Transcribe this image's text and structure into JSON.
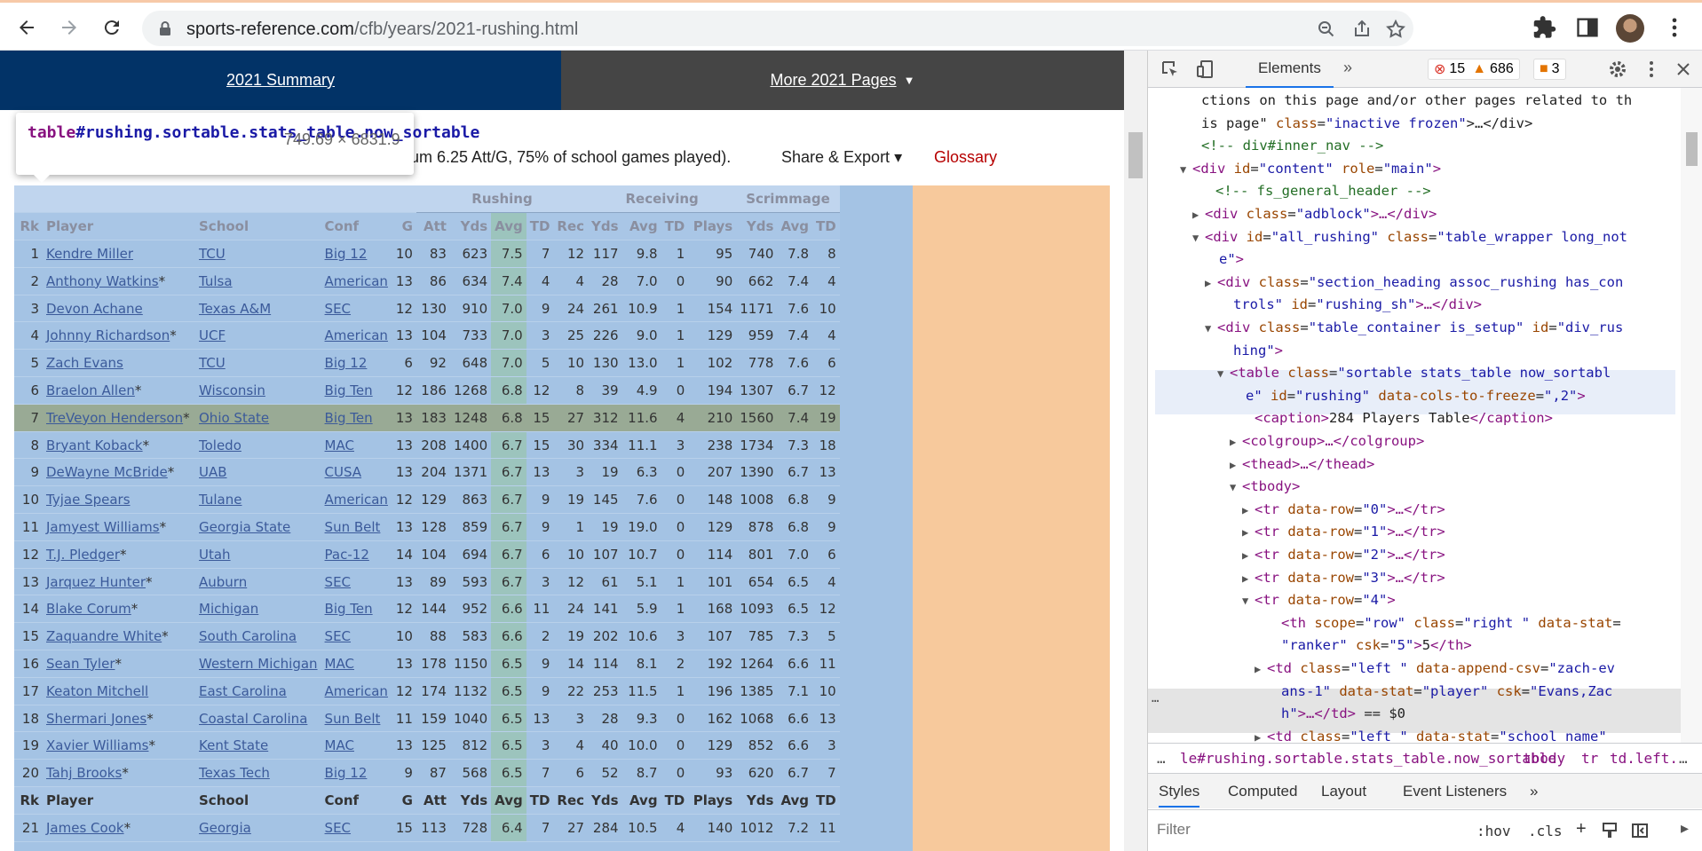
{
  "browser": {
    "url_domain": "sports-reference.com",
    "url_path": "/cfb/years/2021-rushing.html"
  },
  "nav": {
    "summary": "2021 Summary",
    "more": "More 2021 Pages"
  },
  "desc": {
    "text": "num 6.25 Att/G, 75% of school games played).",
    "share": "Share & Export ▾",
    "glossary": "Glossary"
  },
  "tooltip": {
    "tag": "table",
    "selector": "#rushing.sortable.stats_table.now_sortable",
    "dims": "749.69 × 6831.9"
  },
  "table": {
    "groups": [
      "Rushing",
      "Receiving",
      "Scrimmage"
    ],
    "columns": [
      "Rk",
      "Player",
      "School",
      "Conf",
      "G",
      "Att",
      "Yds",
      "Avg",
      "TD",
      "Rec",
      "Yds",
      "Avg",
      "TD",
      "Plays",
      "Yds",
      "Avg",
      "TD"
    ],
    "rows": [
      [
        "1",
        "Kendre Miller",
        "",
        "TCU",
        "Big 12",
        "10",
        "83",
        "623",
        "7.5",
        "7",
        "12",
        "117",
        "9.8",
        "1",
        "95",
        "740",
        "7.8",
        "8"
      ],
      [
        "2",
        "Anthony Watkins",
        "*",
        "Tulsa",
        "American",
        "13",
        "86",
        "634",
        "7.4",
        "4",
        "4",
        "28",
        "7.0",
        "0",
        "90",
        "662",
        "7.4",
        "4"
      ],
      [
        "3",
        "Devon Achane",
        "",
        "Texas A&M",
        "SEC",
        "12",
        "130",
        "910",
        "7.0",
        "9",
        "24",
        "261",
        "10.9",
        "1",
        "154",
        "1171",
        "7.6",
        "10"
      ],
      [
        "4",
        "Johnny Richardson",
        "*",
        "UCF",
        "American",
        "13",
        "104",
        "733",
        "7.0",
        "3",
        "25",
        "226",
        "9.0",
        "1",
        "129",
        "959",
        "7.4",
        "4"
      ],
      [
        "5",
        "Zach Evans",
        "",
        "TCU",
        "Big 12",
        "6",
        "92",
        "648",
        "7.0",
        "5",
        "10",
        "130",
        "13.0",
        "1",
        "102",
        "778",
        "7.6",
        "6"
      ],
      [
        "6",
        "Braelon Allen",
        "*",
        "Wisconsin",
        "Big Ten",
        "12",
        "186",
        "1268",
        "6.8",
        "12",
        "8",
        "39",
        "4.9",
        "0",
        "194",
        "1307",
        "6.7",
        "12"
      ],
      [
        "7",
        "TreVeyon Henderson",
        "*",
        "Ohio State",
        "Big Ten",
        "13",
        "183",
        "1248",
        "6.8",
        "15",
        "27",
        "312",
        "11.6",
        "4",
        "210",
        "1560",
        "7.4",
        "19"
      ],
      [
        "8",
        "Bryant Koback",
        "*",
        "Toledo",
        "MAC",
        "13",
        "208",
        "1400",
        "6.7",
        "15",
        "30",
        "334",
        "11.1",
        "3",
        "238",
        "1734",
        "7.3",
        "18"
      ],
      [
        "9",
        "DeWayne McBride",
        "*",
        "UAB",
        "CUSA",
        "13",
        "204",
        "1371",
        "6.7",
        "13",
        "3",
        "19",
        "6.3",
        "0",
        "207",
        "1390",
        "6.7",
        "13"
      ],
      [
        "10",
        "Tyjae Spears",
        "",
        "Tulane",
        "American",
        "12",
        "129",
        "863",
        "6.7",
        "9",
        "19",
        "145",
        "7.6",
        "0",
        "148",
        "1008",
        "6.8",
        "9"
      ],
      [
        "11",
        "Jamyest Williams",
        "*",
        "Georgia State",
        "Sun Belt",
        "13",
        "128",
        "859",
        "6.7",
        "9",
        "1",
        "19",
        "19.0",
        "0",
        "129",
        "878",
        "6.8",
        "9"
      ],
      [
        "12",
        "T.J. Pledger",
        "*",
        "Utah",
        "Pac-12",
        "14",
        "104",
        "694",
        "6.7",
        "6",
        "10",
        "107",
        "10.7",
        "0",
        "114",
        "801",
        "7.0",
        "6"
      ],
      [
        "13",
        "Jarquez Hunter",
        "*",
        "Auburn",
        "SEC",
        "13",
        "89",
        "593",
        "6.7",
        "3",
        "12",
        "61",
        "5.1",
        "1",
        "101",
        "654",
        "6.5",
        "4"
      ],
      [
        "14",
        "Blake Corum",
        "*",
        "Michigan",
        "Big Ten",
        "12",
        "144",
        "952",
        "6.6",
        "11",
        "24",
        "141",
        "5.9",
        "1",
        "168",
        "1093",
        "6.5",
        "12"
      ],
      [
        "15",
        "Zaquandre White",
        "*",
        "South Carolina",
        "SEC",
        "10",
        "88",
        "583",
        "6.6",
        "2",
        "19",
        "202",
        "10.6",
        "3",
        "107",
        "785",
        "7.3",
        "5"
      ],
      [
        "16",
        "Sean Tyler",
        "*",
        "Western Michigan",
        "MAC",
        "13",
        "178",
        "1150",
        "6.5",
        "9",
        "14",
        "114",
        "8.1",
        "2",
        "192",
        "1264",
        "6.6",
        "11"
      ],
      [
        "17",
        "Keaton Mitchell",
        "",
        "East Carolina",
        "American",
        "12",
        "174",
        "1132",
        "6.5",
        "9",
        "22",
        "253",
        "11.5",
        "1",
        "196",
        "1385",
        "7.1",
        "10"
      ],
      [
        "18",
        "Shermari Jones",
        "*",
        "Coastal Carolina",
        "Sun Belt",
        "11",
        "159",
        "1040",
        "6.5",
        "13",
        "3",
        "28",
        "9.3",
        "0",
        "162",
        "1068",
        "6.6",
        "13"
      ],
      [
        "19",
        "Xavier Williams",
        "*",
        "Kent State",
        "MAC",
        "13",
        "125",
        "812",
        "6.5",
        "3",
        "4",
        "40",
        "10.0",
        "0",
        "129",
        "852",
        "6.6",
        "3"
      ],
      [
        "20",
        "Tahj Brooks",
        "*",
        "Texas Tech",
        "Big 12",
        "9",
        "87",
        "568",
        "6.5",
        "7",
        "6",
        "52",
        "8.7",
        "0",
        "93",
        "620",
        "6.7",
        "7"
      ]
    ],
    "highlight_row": 6,
    "repeat_header": [
      "Rk",
      "Player",
      "School",
      "Conf",
      "G",
      "Att",
      "Yds",
      "Avg",
      "TD",
      "Rec",
      "Yds",
      "Avg",
      "TD",
      "Plays",
      "Yds",
      "Avg",
      "TD"
    ],
    "last_row": [
      "21",
      "James Cook",
      "*",
      "Georgia",
      "SEC",
      "15",
      "113",
      "728",
      "6.4",
      "7",
      "27",
      "284",
      "10.5",
      "4",
      "140",
      "1012",
      "7.2",
      "11"
    ]
  },
  "devtools": {
    "tab": "Elements",
    "errors": "15",
    "warnings": "686",
    "issues": "3",
    "dom_lines": [
      {
        "indent": 60,
        "parts": [
          [
            "tx",
            "ctions on this page and/or other pages related to th"
          ]
        ]
      },
      {
        "indent": 60,
        "parts": [
          [
            "tx",
            "is page\" "
          ],
          [
            "an",
            "class"
          ],
          [
            "tx",
            "="
          ],
          [
            "av",
            "\"inactive frozen\""
          ],
          [
            "tx",
            ">…</div>"
          ]
        ]
      },
      {
        "indent": 60,
        "parts": [
          [
            "cm",
            "<!-- div#inner_nav -->"
          ]
        ]
      },
      {
        "indent": 52,
        "tri": "▼",
        "parts": [
          [
            "tg",
            "<div "
          ],
          [
            "an",
            "id"
          ],
          [
            "tx",
            "="
          ],
          [
            "av",
            "\"content\""
          ],
          [
            "tx",
            " "
          ],
          [
            "an",
            "role"
          ],
          [
            "tx",
            "="
          ],
          [
            "av",
            "\"main\""
          ],
          [
            "tg",
            ">"
          ]
        ]
      },
      {
        "indent": 76,
        "parts": [
          [
            "cm",
            "<!-- fs_general_header -->"
          ]
        ]
      },
      {
        "indent": 66,
        "tri": "▶",
        "parts": [
          [
            "tg",
            "<div "
          ],
          [
            "an",
            "class"
          ],
          [
            "tx",
            "="
          ],
          [
            "av",
            "\"adblock\""
          ],
          [
            "tg",
            ">…</div>"
          ]
        ]
      },
      {
        "indent": 66,
        "tri": "▼",
        "parts": [
          [
            "tg",
            "<div "
          ],
          [
            "an",
            "id"
          ],
          [
            "tx",
            "="
          ],
          [
            "av",
            "\"all_rushing\""
          ],
          [
            "tx",
            " "
          ],
          [
            "an",
            "class"
          ],
          [
            "tx",
            "="
          ],
          [
            "av",
            "\"table_wrapper long_not"
          ]
        ]
      },
      {
        "indent": 80,
        "parts": [
          [
            "av",
            "e\""
          ],
          [
            "tg",
            ">"
          ]
        ]
      },
      {
        "indent": 80,
        "tri": "▶",
        "parts": [
          [
            "tg",
            "<div "
          ],
          [
            "an",
            "class"
          ],
          [
            "tx",
            "="
          ],
          [
            "av",
            "\"section_heading assoc_rushing has_con"
          ]
        ]
      },
      {
        "indent": 96,
        "parts": [
          [
            "av",
            "trols\""
          ],
          [
            "tx",
            " "
          ],
          [
            "an",
            "id"
          ],
          [
            "tx",
            "="
          ],
          [
            "av",
            "\"rushing_sh\""
          ],
          [
            "tg",
            ">…</div>"
          ]
        ]
      },
      {
        "indent": 80,
        "tri": "▼",
        "parts": [
          [
            "tg",
            "<div "
          ],
          [
            "an",
            "class"
          ],
          [
            "tx",
            "="
          ],
          [
            "av",
            "\"table_container is_setup\""
          ],
          [
            "tx",
            " "
          ],
          [
            "an",
            "id"
          ],
          [
            "tx",
            "="
          ],
          [
            "av",
            "\"div_rus"
          ]
        ]
      },
      {
        "indent": 96,
        "parts": [
          [
            "av",
            "hing\""
          ],
          [
            "tg",
            ">"
          ]
        ]
      },
      {
        "indent": 94,
        "tri": "▼",
        "parts": [
          [
            "tg",
            "<table "
          ],
          [
            "an",
            "class"
          ],
          [
            "tx",
            "="
          ],
          [
            "av",
            "\"sortable stats_table now_sortabl"
          ]
        ]
      },
      {
        "indent": 110,
        "parts": [
          [
            "av",
            "e\""
          ],
          [
            "tx",
            " "
          ],
          [
            "an",
            "id"
          ],
          [
            "tx",
            "="
          ],
          [
            "av",
            "\"rushing\""
          ],
          [
            "tx",
            " "
          ],
          [
            "an",
            "data-cols-to-freeze"
          ],
          [
            "tx",
            "="
          ],
          [
            "av",
            "\",2\""
          ],
          [
            "tg",
            ">"
          ]
        ]
      },
      {
        "indent": 120,
        "parts": [
          [
            "tg",
            "<caption>"
          ],
          [
            "tx",
            "284 Players Table"
          ],
          [
            "tg",
            "</caption>"
          ]
        ]
      },
      {
        "indent": 108,
        "tri": "▶",
        "parts": [
          [
            "tg",
            "<colgroup>…</colgroup>"
          ]
        ]
      },
      {
        "indent": 108,
        "tri": "▶",
        "parts": [
          [
            "tg",
            "<thead>…</thead>"
          ]
        ]
      },
      {
        "indent": 108,
        "tri": "▼",
        "parts": [
          [
            "tg",
            "<tbody>"
          ]
        ]
      },
      {
        "indent": 122,
        "tri": "▶",
        "parts": [
          [
            "tg",
            "<tr "
          ],
          [
            "an",
            "data-row"
          ],
          [
            "tx",
            "="
          ],
          [
            "av",
            "\"0\""
          ],
          [
            "tg",
            ">…</tr>"
          ]
        ]
      },
      {
        "indent": 122,
        "tri": "▶",
        "parts": [
          [
            "tg",
            "<tr "
          ],
          [
            "an",
            "data-row"
          ],
          [
            "tx",
            "="
          ],
          [
            "av",
            "\"1\""
          ],
          [
            "tg",
            ">…</tr>"
          ]
        ]
      },
      {
        "indent": 122,
        "tri": "▶",
        "parts": [
          [
            "tg",
            "<tr "
          ],
          [
            "an",
            "data-row"
          ],
          [
            "tx",
            "="
          ],
          [
            "av",
            "\"2\""
          ],
          [
            "tg",
            ">…</tr>"
          ]
        ]
      },
      {
        "indent": 122,
        "tri": "▶",
        "parts": [
          [
            "tg",
            "<tr "
          ],
          [
            "an",
            "data-row"
          ],
          [
            "tx",
            "="
          ],
          [
            "av",
            "\"3\""
          ],
          [
            "tg",
            ">…</tr>"
          ]
        ]
      },
      {
        "indent": 122,
        "tri": "▼",
        "parts": [
          [
            "tg",
            "<tr "
          ],
          [
            "an",
            "data-row"
          ],
          [
            "tx",
            "="
          ],
          [
            "av",
            "\"4\""
          ],
          [
            "tg",
            ">"
          ]
        ]
      },
      {
        "indent": 150,
        "parts": [
          [
            "tg",
            "<th "
          ],
          [
            "an",
            "scope"
          ],
          [
            "tx",
            "="
          ],
          [
            "av",
            "\"row\""
          ],
          [
            "tx",
            " "
          ],
          [
            "an",
            "class"
          ],
          [
            "tx",
            "="
          ],
          [
            "av",
            "\"right \""
          ],
          [
            "tx",
            " "
          ],
          [
            "an",
            "data-stat"
          ],
          [
            "tx",
            "="
          ]
        ]
      },
      {
        "indent": 150,
        "parts": [
          [
            "av",
            "\"ranker\""
          ],
          [
            "tx",
            " "
          ],
          [
            "an",
            "csk"
          ],
          [
            "tx",
            "="
          ],
          [
            "av",
            "\"5\""
          ],
          [
            "tg",
            ">"
          ],
          [
            "tx",
            "5"
          ],
          [
            "tg",
            "</th>"
          ]
        ]
      },
      {
        "indent": 136,
        "tri": "▶",
        "parts": [
          [
            "tg",
            "<td "
          ],
          [
            "an",
            "class"
          ],
          [
            "tx",
            "="
          ],
          [
            "av",
            "\"left \""
          ],
          [
            "tx",
            " "
          ],
          [
            "an",
            "data-append-csv"
          ],
          [
            "tx",
            "="
          ],
          [
            "av",
            "\"zach-ev"
          ]
        ]
      },
      {
        "indent": 150,
        "parts": [
          [
            "av",
            "ans-1\""
          ],
          [
            "tx",
            " "
          ],
          [
            "an",
            "data-stat"
          ],
          [
            "tx",
            "="
          ],
          [
            "av",
            "\"player\""
          ],
          [
            "tx",
            " "
          ],
          [
            "an",
            "csk"
          ],
          [
            "tx",
            "="
          ],
          [
            "av",
            "\"Evans,Zac"
          ]
        ]
      },
      {
        "indent": 150,
        "parts": [
          [
            "av",
            "h\""
          ],
          [
            "tg",
            ">…</td>"
          ],
          [
            "tx",
            " == $0"
          ]
        ]
      },
      {
        "indent": 136,
        "tri": "▶",
        "parts": [
          [
            "tg",
            "<td "
          ],
          [
            "an",
            "class"
          ],
          [
            "tx",
            "="
          ],
          [
            "av",
            "\"left \""
          ],
          [
            "tx",
            " "
          ],
          [
            "an",
            "data-stat"
          ],
          [
            "tx",
            "="
          ],
          [
            "av",
            "\"school_name\""
          ]
        ]
      }
    ],
    "crumbs": [
      "…",
      "le#rushing.sortable.stats_table.now_sortable",
      "tbody",
      "tr",
      "td.left.",
      "…"
    ],
    "styles_tabs": [
      "Styles",
      "Computed",
      "Layout",
      "Event Listeners",
      "»"
    ],
    "filter_placeholder": "Filter",
    "hov": ":hov",
    "cls": ".cls"
  }
}
